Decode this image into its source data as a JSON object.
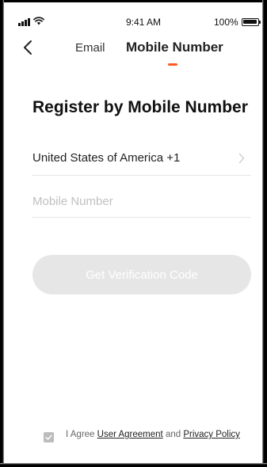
{
  "status_bar": {
    "time": "9:41 AM",
    "battery_percent": "100%",
    "icons": [
      "signal-icon",
      "wifi-icon",
      "battery-icon"
    ]
  },
  "nav": {
    "back_icon": "chevron-left-icon",
    "tabs": [
      {
        "label": "Email",
        "active": false
      },
      {
        "label": "Mobile Number",
        "active": true
      }
    ]
  },
  "main": {
    "title": "Register by Mobile Number",
    "country": {
      "label": "United States of America +1",
      "icon": "chevron-right-icon"
    },
    "phone_input": {
      "value": "",
      "placeholder": "Mobile Number"
    },
    "verify_button_label": "Get Verification Code"
  },
  "agreement": {
    "checked": true,
    "prefix": "I Agree ",
    "user_agreement": "User Agreement",
    "conjunction": " and ",
    "privacy_policy": "Privacy Policy"
  },
  "colors": {
    "accent": "#ff5a1f",
    "button_disabled": "#e6e6e6",
    "placeholder": "#c0c0c0",
    "divider": "#e6e6e6"
  }
}
